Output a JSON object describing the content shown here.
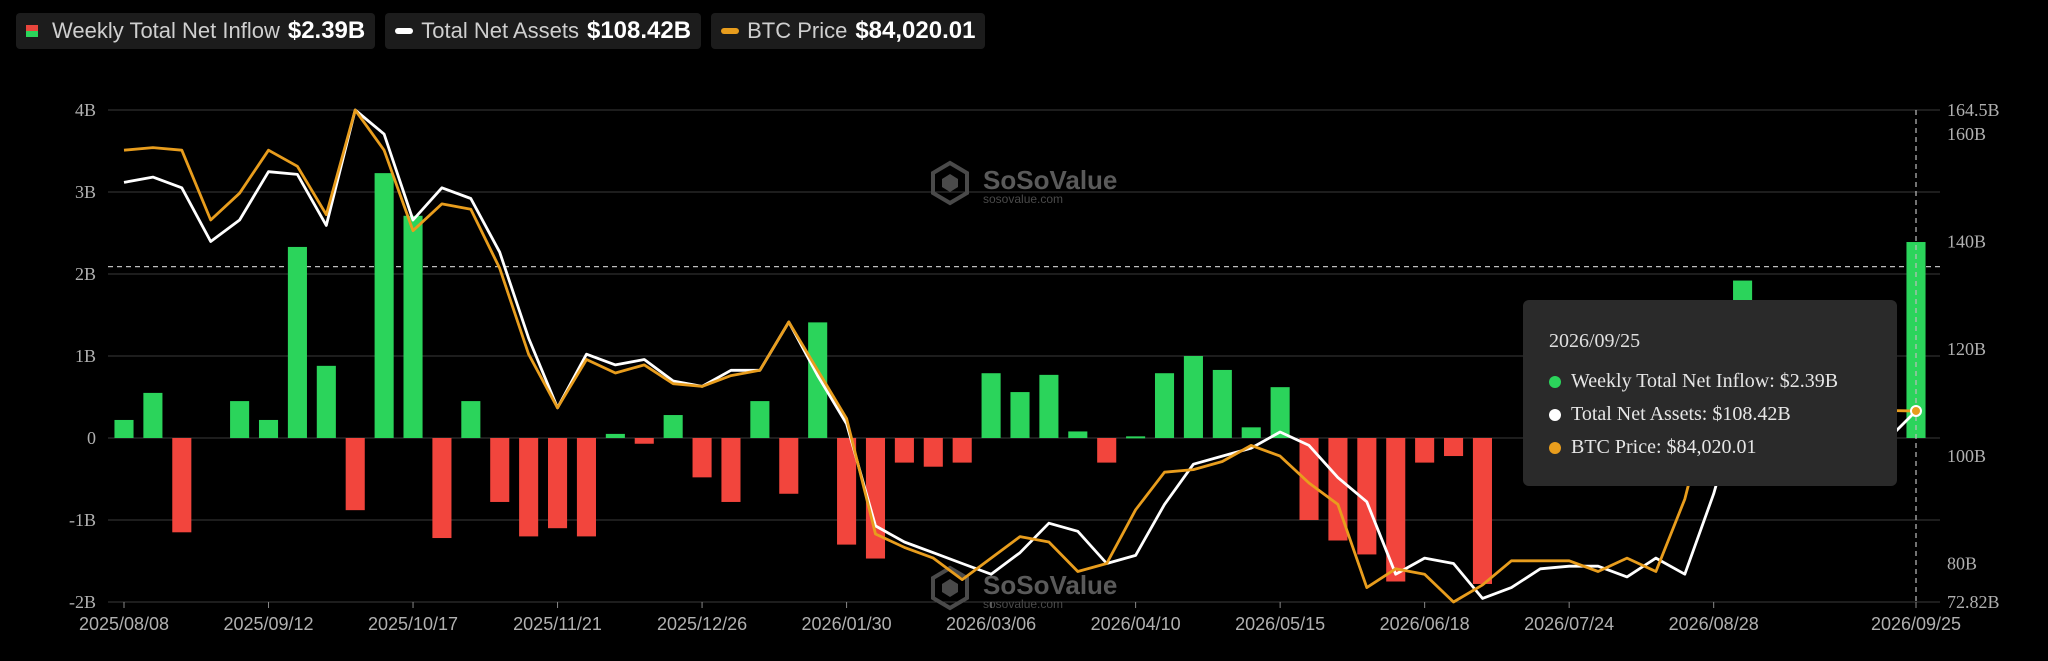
{
  "legend": {
    "inflow_label": "Weekly Total Net Inflow",
    "inflow_value": "$2.39B",
    "assets_label": "Total Net Assets",
    "assets_value": "$108.42B",
    "btc_label": "BTC Price",
    "btc_value": "$84,020.01"
  },
  "tooltip": {
    "date": "2026/09/25",
    "inflow": "Weekly Total Net Inflow: $2.39B",
    "assets": "Total Net Assets: $108.42B",
    "btc": "BTC Price: $84,020.01"
  },
  "watermark": {
    "text": "SoSoValue",
    "sub": "sosovalue.com"
  },
  "colors": {
    "positive": "#2bd45b",
    "negative": "#f2453d",
    "assets_line": "#ffffff",
    "btc_line": "#e89d1d",
    "grid": "#3a3a3a"
  },
  "chart_data": {
    "type": "bar",
    "x_tick_labels": [
      "2025/08/08",
      "2025/09/12",
      "2025/10/17",
      "2025/11/21",
      "2025/12/26",
      "2026/01/30",
      "2026/03/06",
      "2026/04/10",
      "2026/05/15",
      "2026/06/18",
      "2026/07/24",
      "2026/08/28",
      "2026/09/25"
    ],
    "y_left_ticks": [
      "4B",
      "3B",
      "2B",
      "1B",
      "0",
      "-1B",
      "-2B"
    ],
    "y_left_range": [
      -2,
      4
    ],
    "y_right_ticks": [
      "164.5B",
      "160B",
      "140B",
      "120B",
      "100B",
      "80B",
      "72.82B"
    ],
    "y_right_range": [
      72.82,
      164.5
    ],
    "series": [
      {
        "name": "Weekly Total Net Inflow",
        "type": "bar",
        "values": [
          0.22,
          0.55,
          -1.15,
          null,
          0.45,
          0.22,
          2.33,
          0.88,
          -0.88,
          3.23,
          2.71,
          -1.22,
          0.45,
          -0.78,
          -1.2,
          -1.1,
          -1.2,
          0.05,
          -0.07,
          0.28,
          -0.48,
          -0.78,
          0.45,
          -0.68,
          1.41,
          -1.3,
          -1.47,
          -0.3,
          -0.35,
          -0.3,
          0.79,
          0.56,
          0.77,
          0.08,
          -0.3,
          0.02,
          0.79,
          1.0,
          0.83,
          0.13,
          0.62,
          -1.0,
          -1.25,
          -1.42,
          -1.75,
          -0.3,
          -0.22,
          -1.78,
          null,
          null,
          null,
          null,
          null,
          null,
          null,
          null,
          1.92,
          null,
          null,
          null,
          null,
          null,
          2.39
        ]
      },
      {
        "name": "Total Net Assets",
        "type": "line",
        "values": [
          151,
          152,
          150,
          140,
          144,
          153,
          152.5,
          143,
          164.5,
          160,
          144,
          150,
          148,
          138,
          122,
          109,
          119,
          117,
          118,
          114,
          113,
          116,
          116,
          125,
          115,
          106,
          87,
          84,
          82,
          80,
          78,
          82,
          87.5,
          86,
          80,
          81.5,
          91,
          98.5,
          100,
          101.5,
          104.5,
          102,
          96,
          91.5,
          78,
          81,
          80,
          73.5,
          75.5,
          79,
          79.5,
          79.5,
          77.5,
          81,
          78,
          93,
          112,
          113,
          108,
          104,
          103,
          103,
          108.42
        ]
      },
      {
        "name": "BTC Price",
        "type": "line",
        "values": [
          157,
          157.5,
          157,
          144,
          149,
          157,
          154,
          145,
          164.5,
          157,
          142,
          147,
          146,
          135,
          119,
          109,
          118,
          115.5,
          117,
          113.5,
          113,
          115,
          116,
          125,
          116,
          107,
          85.5,
          83,
          81,
          77,
          81,
          85,
          84,
          78.5,
          80,
          90,
          97,
          97.5,
          99,
          102,
          100,
          95,
          91,
          75.5,
          79,
          78,
          72.82,
          76,
          80.5,
          80.5,
          80.5,
          78.5,
          81,
          78.5,
          92,
          113,
          114,
          109,
          103,
          105,
          106,
          108.5,
          108.42
        ]
      }
    ]
  }
}
